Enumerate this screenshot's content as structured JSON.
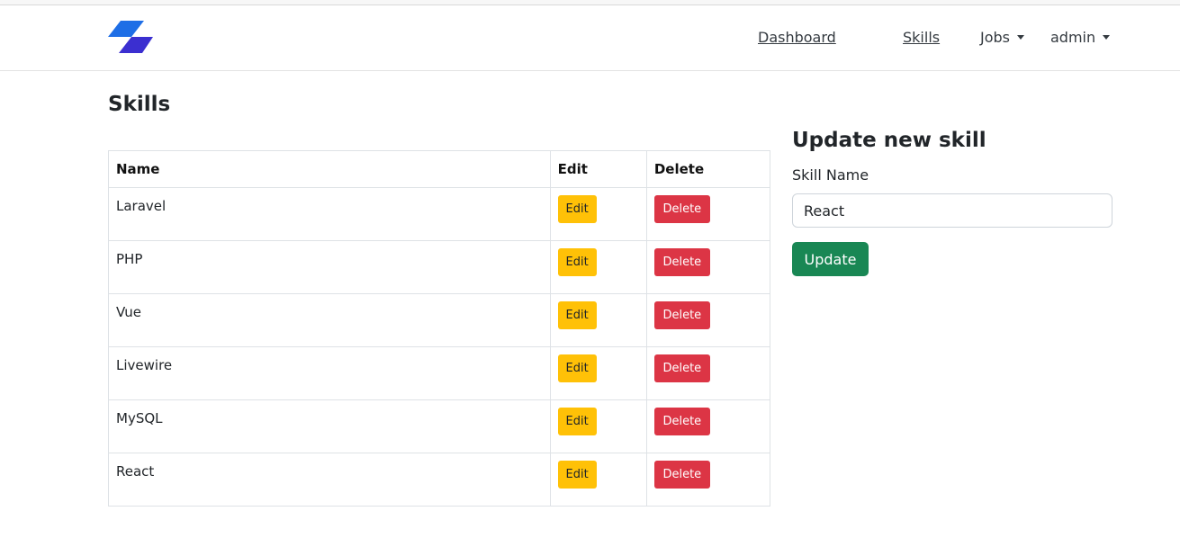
{
  "nav": {
    "logo_icon": "parallelogram-logo-icon",
    "items": [
      "Dashboard",
      "Skills"
    ],
    "jobs_label": "Jobs",
    "user_label": "admin"
  },
  "page": {
    "title": "Skills"
  },
  "table": {
    "headers": [
      "Name",
      "Edit",
      "Delete"
    ],
    "rows": [
      {
        "name": "Laravel",
        "edit": "Edit",
        "delete": "Delete"
      },
      {
        "name": "PHP",
        "edit": "Edit",
        "delete": "Delete"
      },
      {
        "name": "Vue",
        "edit": "Edit",
        "delete": "Delete"
      },
      {
        "name": "Livewire",
        "edit": "Edit",
        "delete": "Delete"
      },
      {
        "name": "MySQL",
        "edit": "Edit",
        "delete": "Delete"
      },
      {
        "name": "React",
        "edit": "Edit",
        "delete": "Delete"
      }
    ]
  },
  "form": {
    "title": "Update new skill",
    "label": "Skill Name",
    "value": "React",
    "submit_label": "Update"
  },
  "colors": {
    "logo_primary": "#1e6ee6",
    "logo_secondary": "#3b2fd0",
    "edit": "#ffc107",
    "delete": "#dc3545",
    "update": "#198754"
  }
}
